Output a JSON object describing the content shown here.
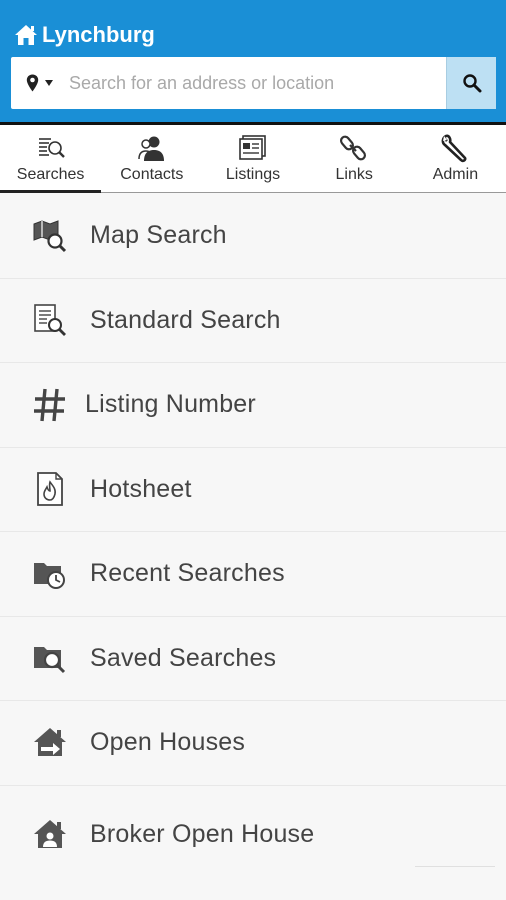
{
  "header": {
    "brand": "Lynchburg",
    "brand_icon": "home-icon",
    "search_placeholder": "Search for an address or location",
    "location_icon": "map-pin-icon",
    "search_icon": "magnifier-icon",
    "colors": {
      "header_bg": "#1a8fd6",
      "search_button_bg": "#bde0f3"
    }
  },
  "tabs": [
    {
      "label": "Searches",
      "icon": "searches-icon",
      "active": true
    },
    {
      "label": "Contacts",
      "icon": "contacts-icon",
      "active": false
    },
    {
      "label": "Listings",
      "icon": "listings-icon",
      "active": false
    },
    {
      "label": "Links",
      "icon": "links-icon",
      "active": false
    },
    {
      "label": "Admin",
      "icon": "wrench-icon",
      "active": false
    }
  ],
  "menu": [
    {
      "label": "Map Search",
      "icon": "map-search-icon"
    },
    {
      "label": "Standard Search",
      "icon": "standard-search-icon"
    },
    {
      "label": "Listing Number",
      "icon": "hash-icon"
    },
    {
      "label": "Hotsheet",
      "icon": "hotsheet-fire-icon"
    },
    {
      "label": "Recent Searches",
      "icon": "folder-clock-icon"
    },
    {
      "label": "Saved Searches",
      "icon": "folder-search-icon"
    },
    {
      "label": "Open Houses",
      "icon": "open-house-icon"
    },
    {
      "label": "Broker Open House",
      "icon": "broker-open-house-icon"
    }
  ]
}
